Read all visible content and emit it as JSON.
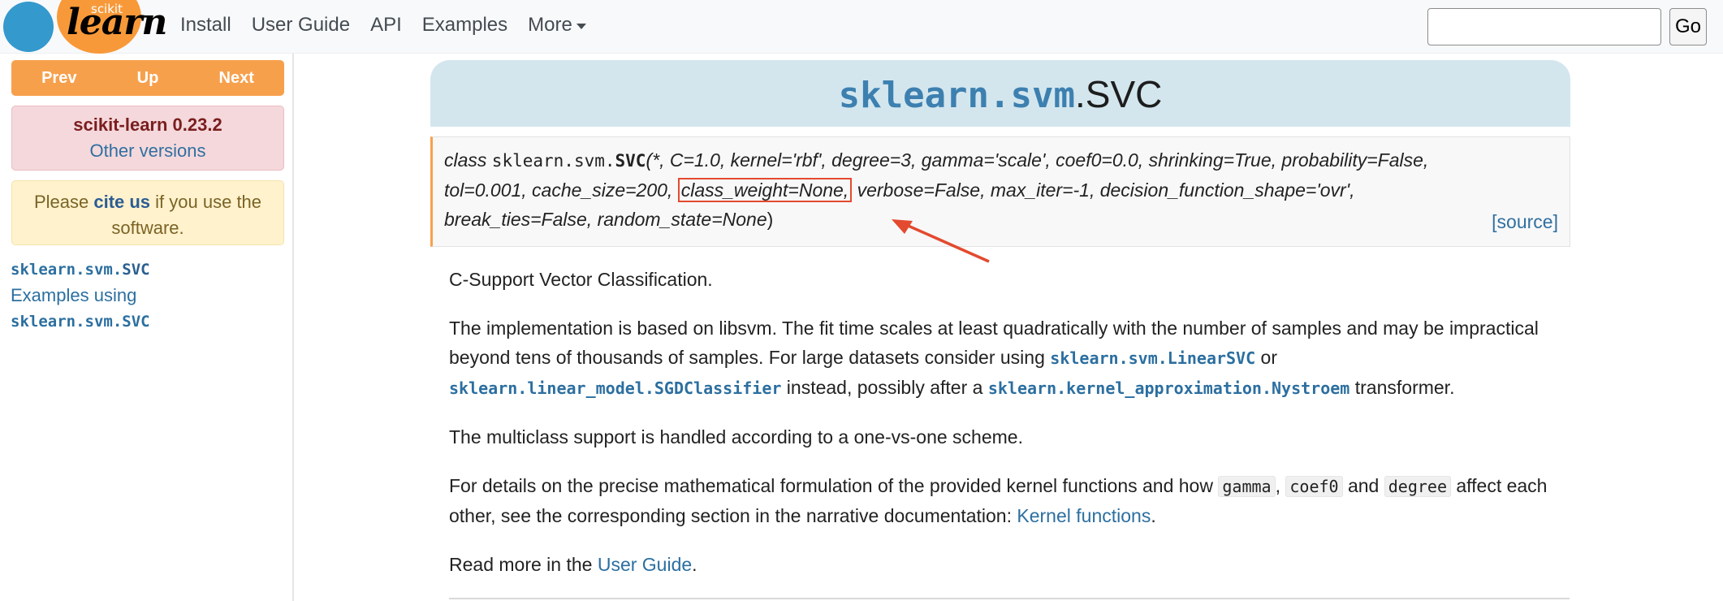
{
  "brand": {
    "scikit": "scikit",
    "learn": "learn"
  },
  "nav": {
    "install": "Install",
    "user_guide": "User Guide",
    "api": "API",
    "examples": "Examples",
    "more": "More"
  },
  "search": {
    "value": "",
    "go_label": "Go"
  },
  "sidebar": {
    "prev": "Prev",
    "up": "Up",
    "next": "Next",
    "version": "scikit-learn 0.23.2",
    "other_versions": "Other versions",
    "cite_prefix": "Please ",
    "cite_link": "cite us",
    "cite_suffix": " if you use the software.",
    "toc_module": "sklearn.svm.",
    "toc_class": "SVC",
    "toc_examples": "Examples using",
    "toc_examples_code": "sklearn.svm.SVC"
  },
  "title": {
    "module": "sklearn.svm",
    "class": ".SVC"
  },
  "signature": {
    "keyword": "class ",
    "path": "sklearn.svm.",
    "name": "SVC",
    "params_line1": "(*, C=1.0, kernel='rbf', degree=3, gamma='scale', coef0=0.0, shrinking=True, probability=False,",
    "params_line2_pre": "tol=0.001, cache_size=200, ",
    "highlighted_param": "class_weight=None,",
    "params_line2_post": " verbose=False, max_iter=-1, decision_function_shape='ovr',",
    "params_line3": "break_ties=False, random_state=None",
    "close": ")",
    "source": "[source]"
  },
  "content": {
    "p1": "C-Support Vector Classification.",
    "p2_a": "The implementation is based on libsvm. The fit time scales at least quadratically with the number of samples and may be impractical beyond tens of thousands of samples. For large datasets consider using ",
    "p2_link1": "sklearn.svm.LinearSVC",
    "p2_b": " or ",
    "p2_link2": "sklearn.linear_model.SGDClassifier",
    "p2_c": " instead, possibly after a ",
    "p2_link3": "sklearn.kernel_approximation.Nystroem",
    "p2_d": " transformer.",
    "p3": "The multiclass support is handled according to a one-vs-one scheme.",
    "p4_a": "For details on the precise mathematical formulation of the provided kernel functions and how ",
    "p4_code1": "gamma",
    "p4_b": ", ",
    "p4_code2": "coef0",
    "p4_c": " and ",
    "p4_code3": "degree",
    "p4_d": " affect each other, see the corresponding section in the narrative documentation: ",
    "p4_link": "Kernel functions",
    "p4_e": ".",
    "p5_a": "Read more in the ",
    "p5_link": "User Guide",
    "p5_b": "."
  },
  "colors": {
    "accent_orange": "#f7a04c",
    "link_blue": "#2c6fa0",
    "annotation_red": "#e34a2f"
  }
}
